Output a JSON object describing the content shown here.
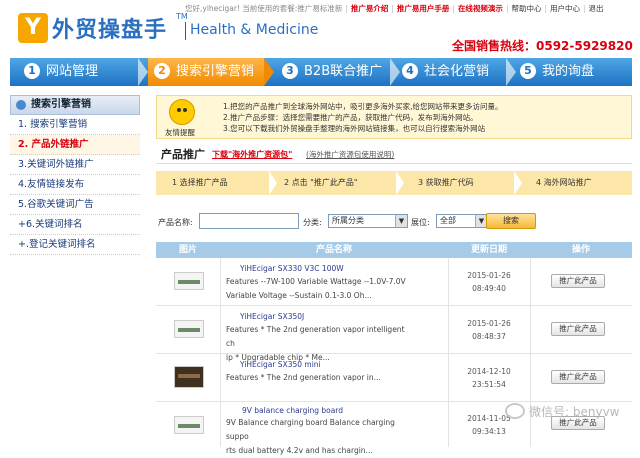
{
  "header": {
    "logo_text": "外贸操盘手",
    "logo_mark": "Y",
    "tm": "TM",
    "subtitle": "Health & Medicine",
    "topbar": {
      "welcome": "您好,yihecigar! 当前使用的套餐:推广易标准新",
      "links": [
        "推广易介绍",
        "推广易用户手册",
        "在线视频演示",
        "帮助中心",
        "用户中心",
        "退出"
      ]
    },
    "hotline": "全国销售热线：0592-5929820"
  },
  "nav": [
    {
      "num": "1",
      "label": "网站管理"
    },
    {
      "num": "2",
      "label": "搜索引擎营销"
    },
    {
      "num": "3",
      "label": "B2B联合推广"
    },
    {
      "num": "4",
      "label": "社会化营销"
    },
    {
      "num": "5",
      "label": "我的询盘"
    }
  ],
  "sidebar": {
    "title": "搜索引擎营销",
    "items": [
      "1. 搜索引擎营销",
      "2. 产品外链推广",
      "3.关键词外链推广",
      "4.友情链接发布",
      "5.谷歌关键词广告",
      "+6.关键词排名",
      "+.登记关键词排名"
    ]
  },
  "tip": {
    "label": "友情提醒",
    "lines": [
      "1.把您的产品推广到全球海外网站中，吸引更多海外买家,给您网站带来更多访问量。",
      "2.推广产品步骤：选择您需要推广的产品，获取推广代码，发布到海外网站。",
      "3.您可以下载我们外贸操盘手整理的海外网站链接集，也可以自行搜索海外网站"
    ]
  },
  "product_section": {
    "title": "产品推广",
    "download_link": "下载\"海外推广资源包\"",
    "guide_link": "(海外推广资源包使用说明)"
  },
  "steps": [
    "1 选择推广产品",
    "2 点击 \"推广此产品\"",
    "3 获取推广代码",
    "4 海外网站推广"
  ],
  "search": {
    "name_label": "产品名称:",
    "name_value": "",
    "category_label": "分类:",
    "category_value": "所属分类",
    "show_label": "展位:",
    "show_value": "全部",
    "button": "搜索"
  },
  "table": {
    "headers": [
      "图片",
      "产品名称",
      "更新日期",
      "操作"
    ],
    "rows": [
      {
        "name": "YiHEcigar SX330 V3C 100W",
        "desc_lines": [
          "Features --7W-100 Variable Wattage --1.0V-7.0V",
          "Variable Voltage --Sustain 0.1-3.0 Oh..."
        ],
        "date": "2015-01-26",
        "time": "08:49:40",
        "action": "推广此产品"
      },
      {
        "name": "YiHEcigar SX350J",
        "desc_lines": [
          "Features * The 2nd generation vapor intelligent ch",
          "ip * Upgradable chip * Me..."
        ],
        "date": "2015-01-26",
        "time": "08:48:37",
        "action": "推广此产品"
      },
      {
        "name": "YiHEcigar SX350 mini",
        "desc_lines": [
          "Features * The 2nd generation vapor in..."
        ],
        "date": "2014-12-10",
        "time": "23:51:54",
        "action": "推广此产品"
      },
      {
        "name": "9V balance charging board",
        "desc_lines": [
          "9V Balance charging board Balance charging suppo",
          "rts dual battery  4.2v and has chargin..."
        ],
        "date": "2014-11-05",
        "time": "09:34:13",
        "action": "推广此产品"
      }
    ]
  },
  "watermark": "微信号: benyvw"
}
